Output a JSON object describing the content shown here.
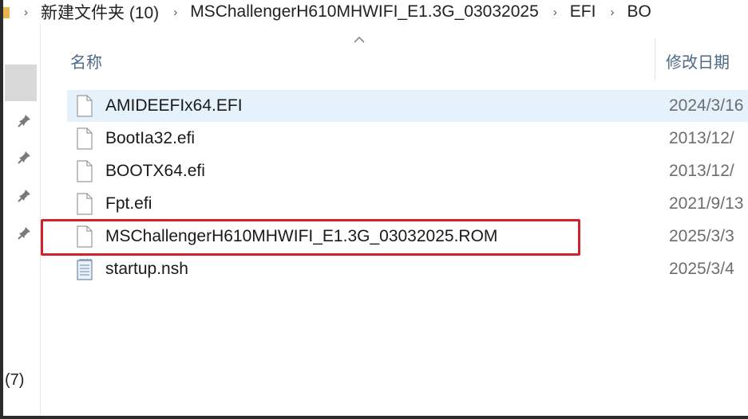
{
  "breadcrumb": {
    "items": [
      "新建文件夹 (10)",
      "MSChallengerH610MHWIFI_E1.3G_03032025",
      "EFI",
      "BO"
    ]
  },
  "nav": {
    "count_label": "(7)"
  },
  "columns": {
    "name": "名称",
    "date": "修改日期"
  },
  "files": [
    {
      "name": "AMIDEEFIx64.EFI",
      "date": "2024/3/16",
      "icon": "generic-file-icon"
    },
    {
      "name": "BootIa32.efi",
      "date": "2013/12/",
      "icon": "generic-file-icon"
    },
    {
      "name": "BOOTX64.efi",
      "date": "2013/12/",
      "icon": "generic-file-icon"
    },
    {
      "name": "Fpt.efi",
      "date": "2021/9/13",
      "icon": "generic-file-icon"
    },
    {
      "name": "MSChallengerH610MHWIFI_E1.3G_03032025.ROM",
      "date": "2025/3/3",
      "icon": "generic-file-icon"
    },
    {
      "name": "startup.nsh",
      "date": "2025/3/4",
      "icon": "text-file-icon"
    }
  ],
  "colors": {
    "highlight": "#d0222b",
    "hover_row": "#e5f1fb",
    "header_text": "#4d6b88"
  }
}
